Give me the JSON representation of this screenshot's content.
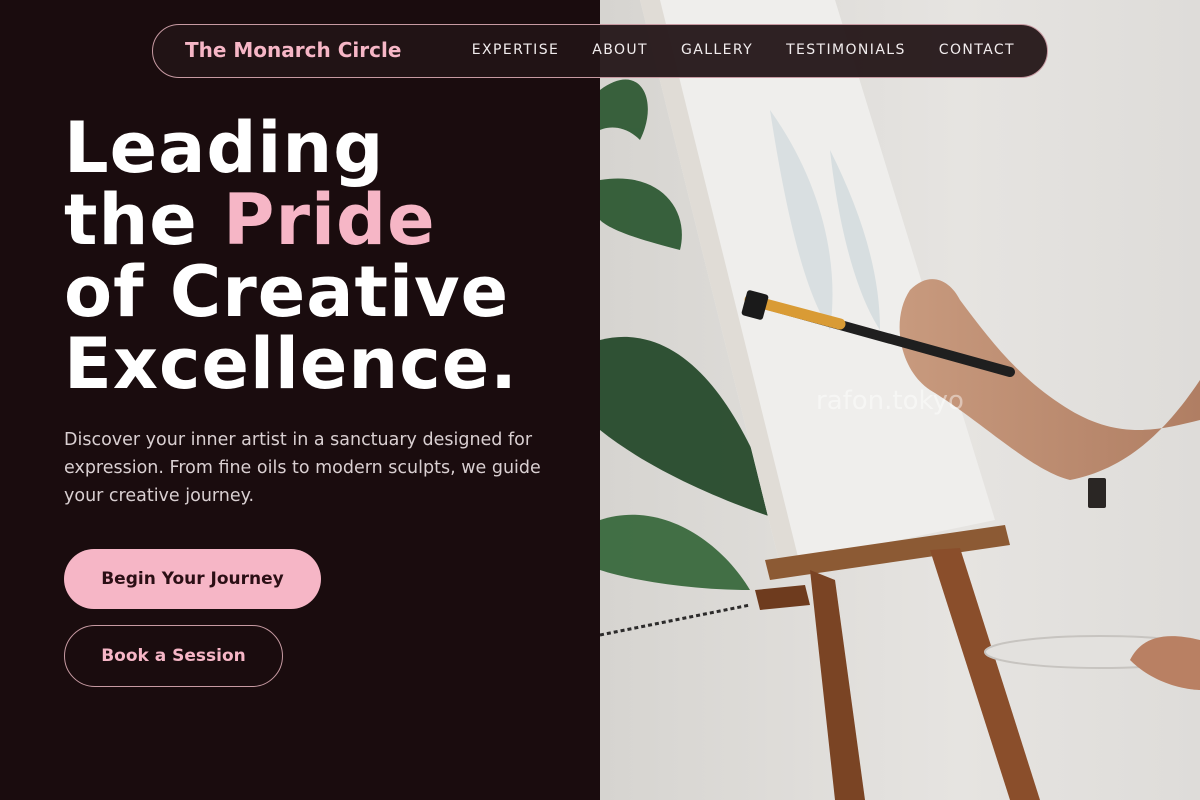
{
  "nav": {
    "brand": "The Monarch Circle",
    "links": [
      "EXPERTISE",
      "ABOUT",
      "GALLERY",
      "TESTIMONIALS",
      "CONTACT"
    ]
  },
  "hero": {
    "line1": "Leading",
    "line2_prefix": "the ",
    "line2_highlight": "Pride",
    "line3": "of Creative",
    "line4": "Excellence.",
    "description": "Discover your inner artist in a sanctuary designed for expression. From fine oils to modern sculpts, we guide your creative journey.",
    "primary_cta": "Begin Your Journey",
    "secondary_cta": "Book a Session"
  },
  "image": {
    "watermark": "rafon.tokyo"
  },
  "colors": {
    "background": "#1a0c0e",
    "accent": "#f6b6c6",
    "nav_border": "#c79aa2"
  }
}
